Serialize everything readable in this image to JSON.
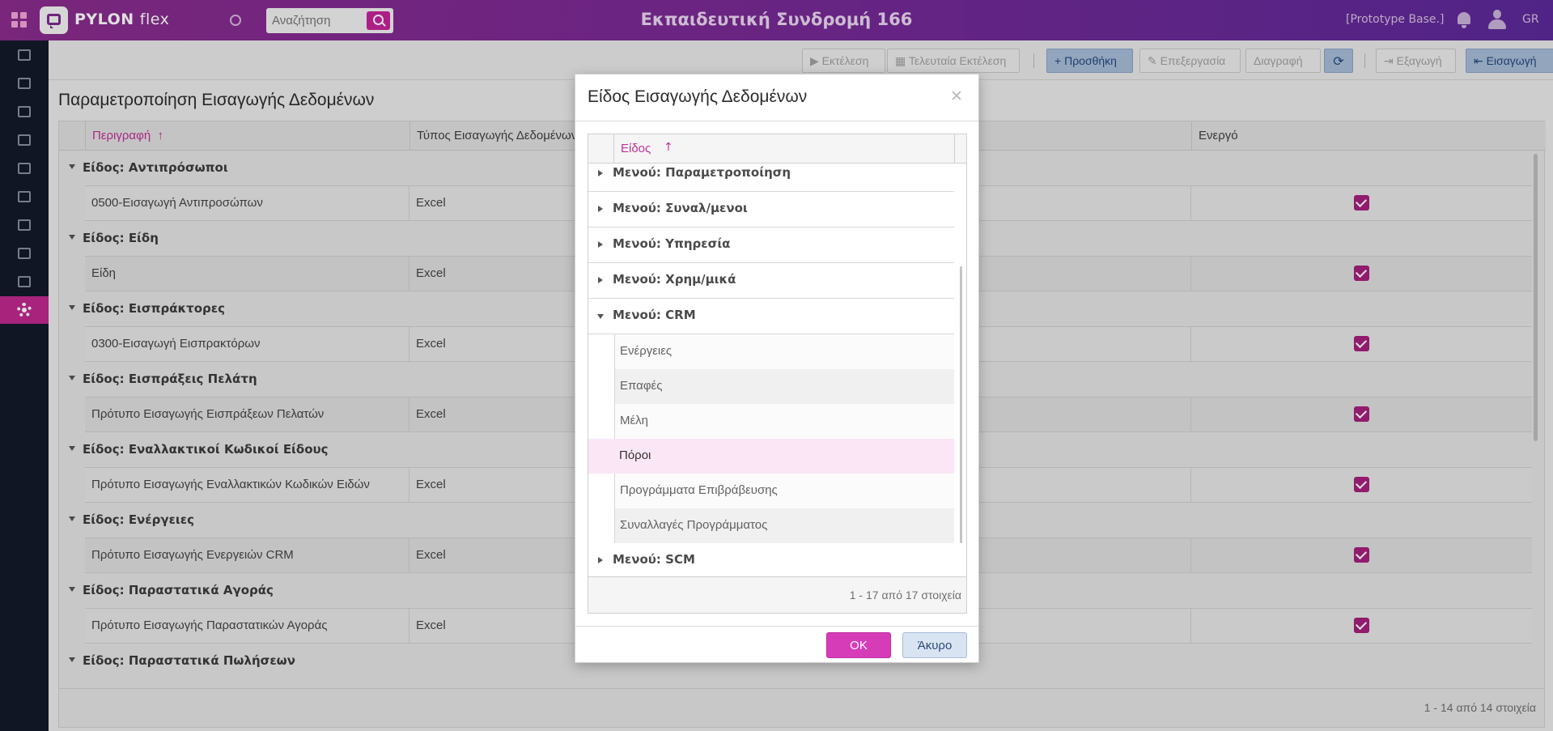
{
  "header": {
    "logo_text": "PYLON",
    "logo_suffix": "flex",
    "search_placeholder": "Αναζήτηση",
    "app_title": "Εκπαιδευτική Συνδρομή 166",
    "prototype_label": "[Prototype Base.]",
    "language": "GR"
  },
  "sidebar": {
    "items": [
      "document-icon",
      "store-icon",
      "layers-icon",
      "exchange-icon",
      "book-icon",
      "contacts-icon",
      "scale-icon",
      "truck-icon",
      "file-icon",
      "gear-icon"
    ],
    "active": "gear-icon"
  },
  "toolbar": {
    "run": "Εκτέλεση",
    "last_run": "Τελευταία Εκτέλεση",
    "add": "Προσθήκη",
    "edit": "Επεξεργασία",
    "delete": "Διαγραφή",
    "export": "Εξαγωγή",
    "import": "Εισαγωγή"
  },
  "page": {
    "title": "Παραμετροποίηση Εισαγωγής Δεδομένων",
    "columns": [
      "Περιγραφή",
      "Τύπος Εισαγωγής Δεδομένων",
      "Ενεργό"
    ],
    "groups": [
      {
        "title": "Είδος: Αντιπρόσωποι",
        "rows": [
          {
            "description": "0500-Εισαγωγή Αντιπροσώπων",
            "type": "Excel",
            "active": true
          }
        ]
      },
      {
        "title": "Είδος: Είδη",
        "rows": [
          {
            "description": "Είδη",
            "type": "Excel",
            "active": true
          }
        ]
      },
      {
        "title": "Είδος: Εισπράκτορες",
        "rows": [
          {
            "description": "0300-Εισαγωγή Εισπρακτόρων",
            "type": "Excel",
            "active": true
          }
        ]
      },
      {
        "title": "Είδος: Εισπράξεις Πελάτη",
        "rows": [
          {
            "description": "Πρότυπο Εισαγωγής Εισπράξεων Πελατών",
            "type": "Excel",
            "active": true
          }
        ]
      },
      {
        "title": "Είδος: Εναλλακτικοί Κωδικοί Είδους",
        "rows": [
          {
            "description": "Πρότυπο Εισαγωγής Εναλλακτικών Κωδικών Ειδών",
            "type": "Excel",
            "active": true
          }
        ]
      },
      {
        "title": "Είδος: Ενέργειες",
        "rows": [
          {
            "description": "Πρότυπο Εισαγωγής Ενεργειών CRM",
            "type": "Excel",
            "active": true
          }
        ]
      },
      {
        "title": "Είδος: Παραστατικά Αγοράς",
        "rows": [
          {
            "description": "Πρότυπο Εισαγωγής Παραστατικών Αγοράς",
            "type": "Excel",
            "active": true
          }
        ]
      },
      {
        "title": "Είδος: Παραστατικά Πωλήσεων",
        "rows": []
      }
    ],
    "footer": "1 - 14 από 14 στοιχεία"
  },
  "dialog": {
    "title": "Είδος Εισαγωγής Δεδομένων",
    "column": "Είδος",
    "groups": [
      {
        "title": "Μενού: Παραμετροποίηση",
        "expanded": false
      },
      {
        "title": "Μενού: Συναλ/μενοι",
        "expanded": false
      },
      {
        "title": "Μενού: Υπηρεσία",
        "expanded": false
      },
      {
        "title": "Μενού: Χρημ/μικά",
        "expanded": false
      },
      {
        "title": "Μενού: CRM",
        "expanded": true
      },
      {
        "title": "Μενού: SCM",
        "expanded": false
      }
    ],
    "crm_items": [
      "Ενέργειες",
      "Επαφές",
      "Μέλη",
      "Πόροι",
      "Προγράμματα Επιβράβευσης",
      "Συναλλαγές Προγράμματος"
    ],
    "selected_item": "Πόροι",
    "footer": "1 - 17 από 17 στοιχεία",
    "ok": "OK",
    "cancel": "Άκυρο"
  },
  "colors": {
    "accent": "#c0288e",
    "header_from": "#8a2c8c",
    "header_to": "#5c2a9a",
    "sidebar": "#141a2b",
    "selected_row": "#fae6f4"
  }
}
